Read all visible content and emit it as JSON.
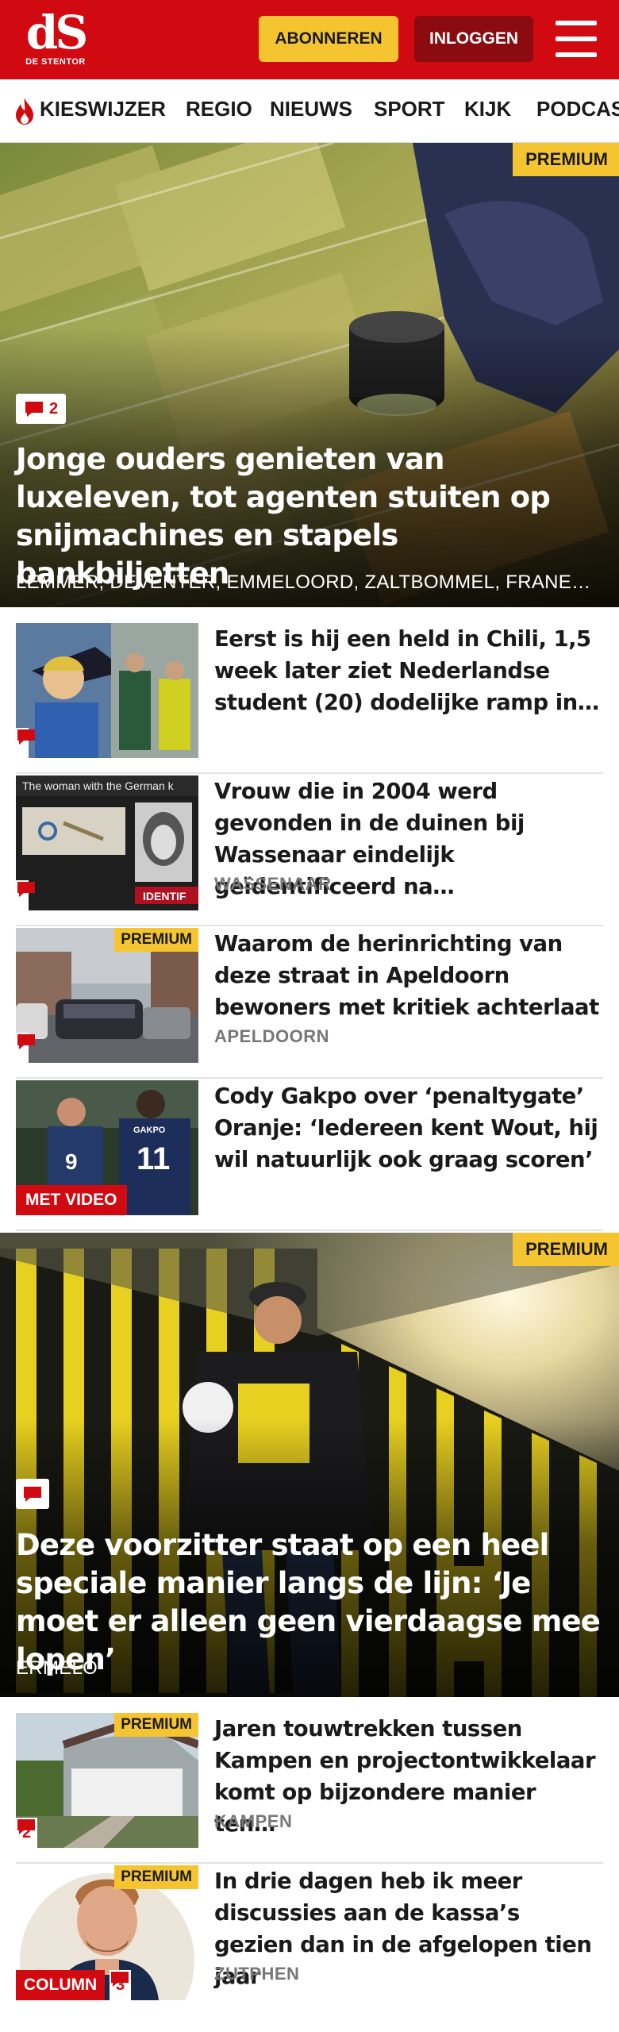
{
  "header": {
    "logo_mark": "dS",
    "logo_sub": "DE STENTOR",
    "subscribe_label": "ABONNEREN",
    "login_label": "INLOGGEN",
    "brand_color": "#d10a11",
    "accent_color": "#f5c531"
  },
  "nav": {
    "items": [
      "KIESWIJZER",
      "REGIO",
      "NIEUWS",
      "SPORT",
      "KIJK",
      "PODCAST"
    ]
  },
  "hero1": {
    "premium": "PREMIUM",
    "comments": "2",
    "title": "Jonge ouders genieten van luxeleven, tot agenten stuiten op snijmachines en stapels bankbiljetten",
    "location": "LEMMER, DEVENTER, EMMELOORD, ZALTBOMMEL, FRANEKER"
  },
  "articles": [
    {
      "title": "Eerst is hij een held in Chili, 1,5 week later ziet Nederlandse student (20) dodelijke ramp in…",
      "location": "",
      "icon": "comment-icon"
    },
    {
      "title": "Vrouw die in 2004 werd gevonden in de duinen bij Wassenaar eindelijk geïdentificeerd na…",
      "location": "WASSENAAR",
      "thumb_text": "The woman with the German k",
      "thumb_text2": "IDENTIF",
      "icon": "comment-icon"
    },
    {
      "premium": "PREMIUM",
      "title": "Waarom de herinrichting van deze straat in Apeldoorn bewoners met kritiek achterlaat",
      "location": "APELDOORN",
      "icon": "comment-icon"
    },
    {
      "label": "MET VIDEO",
      "title": "Cody Gakpo over ‘penaltygate’ Oranje: ‘Iedereen kent Wout, hij wil natuurlijk ook graag scoren’",
      "location": "",
      "shirt1": "9",
      "shirt2": "11",
      "shirt2_name": "GAKPO"
    }
  ],
  "hero2": {
    "premium": "PREMIUM",
    "title": "Deze voorzitter staat op een heel speciale manier langs de lijn: ‘Je moet er alleen geen vierdaagse mee lopen’",
    "location": "ERMELO"
  },
  "articles2": [
    {
      "premium": "PREMIUM",
      "comments": "2",
      "title": "Jaren touwtrekken tussen Kampen en projectontwikkelaar komt op bijzondere manier ten…",
      "location": "KAMPEN"
    },
    {
      "premium": "PREMIUM",
      "label": "COLUMN",
      "comments": "3",
      "title": "In drie dagen heb ik meer discussies aan de kassa’s gezien dan in de afgelopen tien jaar",
      "location": "ZUTPHEN"
    }
  ]
}
